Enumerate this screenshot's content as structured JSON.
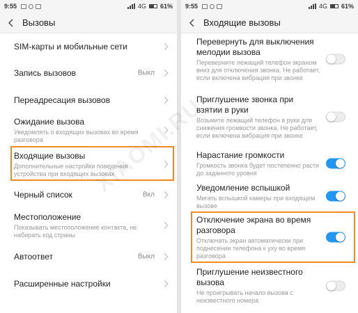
{
  "left": {
    "status": {
      "time": "9:55",
      "network": "4G",
      "battery": "61%"
    },
    "title": "Вызовы",
    "items": [
      {
        "label": "SIM-карты и мобильные сети"
      },
      {
        "label": "Запись вызовов",
        "value": "Выкл"
      },
      {
        "label": "Переадресация вызовов"
      },
      {
        "label": "Ожидание вызова",
        "sub": "Уведомлять о входящих вызовах во время разговора"
      },
      {
        "label": "Входящие вызовы",
        "sub": "Дополнительные настройки поведения устройства при входящих вызовах"
      },
      {
        "label": "Черный список",
        "value": "Вкл"
      },
      {
        "label": "Местоположение",
        "sub": "Показывать местоположение контакта, не набирать код страны"
      },
      {
        "label": "Автоответ",
        "value": "Выкл"
      },
      {
        "label": "Расширенные настройки"
      }
    ]
  },
  "right": {
    "status": {
      "time": "9:55",
      "network": "4G",
      "battery": "61%"
    },
    "title": "Входящие вызовы",
    "items": [
      {
        "label": "Перевернуть для выключения мелодии вызова",
        "sub": "Переверните лежащий телефон экраном вниз для отключения звонка. Не работает, если включена вибрация при звонке",
        "toggle": "off"
      },
      {
        "label": "Приглушение звонка при взятии в руки",
        "sub": "Возьмите лежащий телефон в руки для снижения громкости звонка. Не работает, если включена вибрация при звонке",
        "toggle": "off"
      },
      {
        "label": "Нарастание громкости",
        "sub": "Громкость звонка будет постепенно расти до заданного уровня",
        "toggle": "on"
      },
      {
        "label": "Уведомление вспышкой",
        "sub": "Мигать вспышкой камеры при входящем вызове",
        "toggle": "on"
      },
      {
        "label": "Отключение экрана во время разговора",
        "sub": "Отключать экран автоматически при поднесении телефона к уху во время разговора",
        "toggle": "on"
      },
      {
        "label": "Приглушение неизвестного вызова",
        "sub": "Не проигрывать начало вызова с неизвестного номера",
        "toggle": "off"
      }
    ]
  },
  "watermark": "XIAOMI.RU",
  "colors": {
    "accent": "#2196f3",
    "highlight": "#f08a24"
  },
  "icons": [
    "back-arrow-icon",
    "chevron-right-icon",
    "toggle-switch-icon"
  ]
}
